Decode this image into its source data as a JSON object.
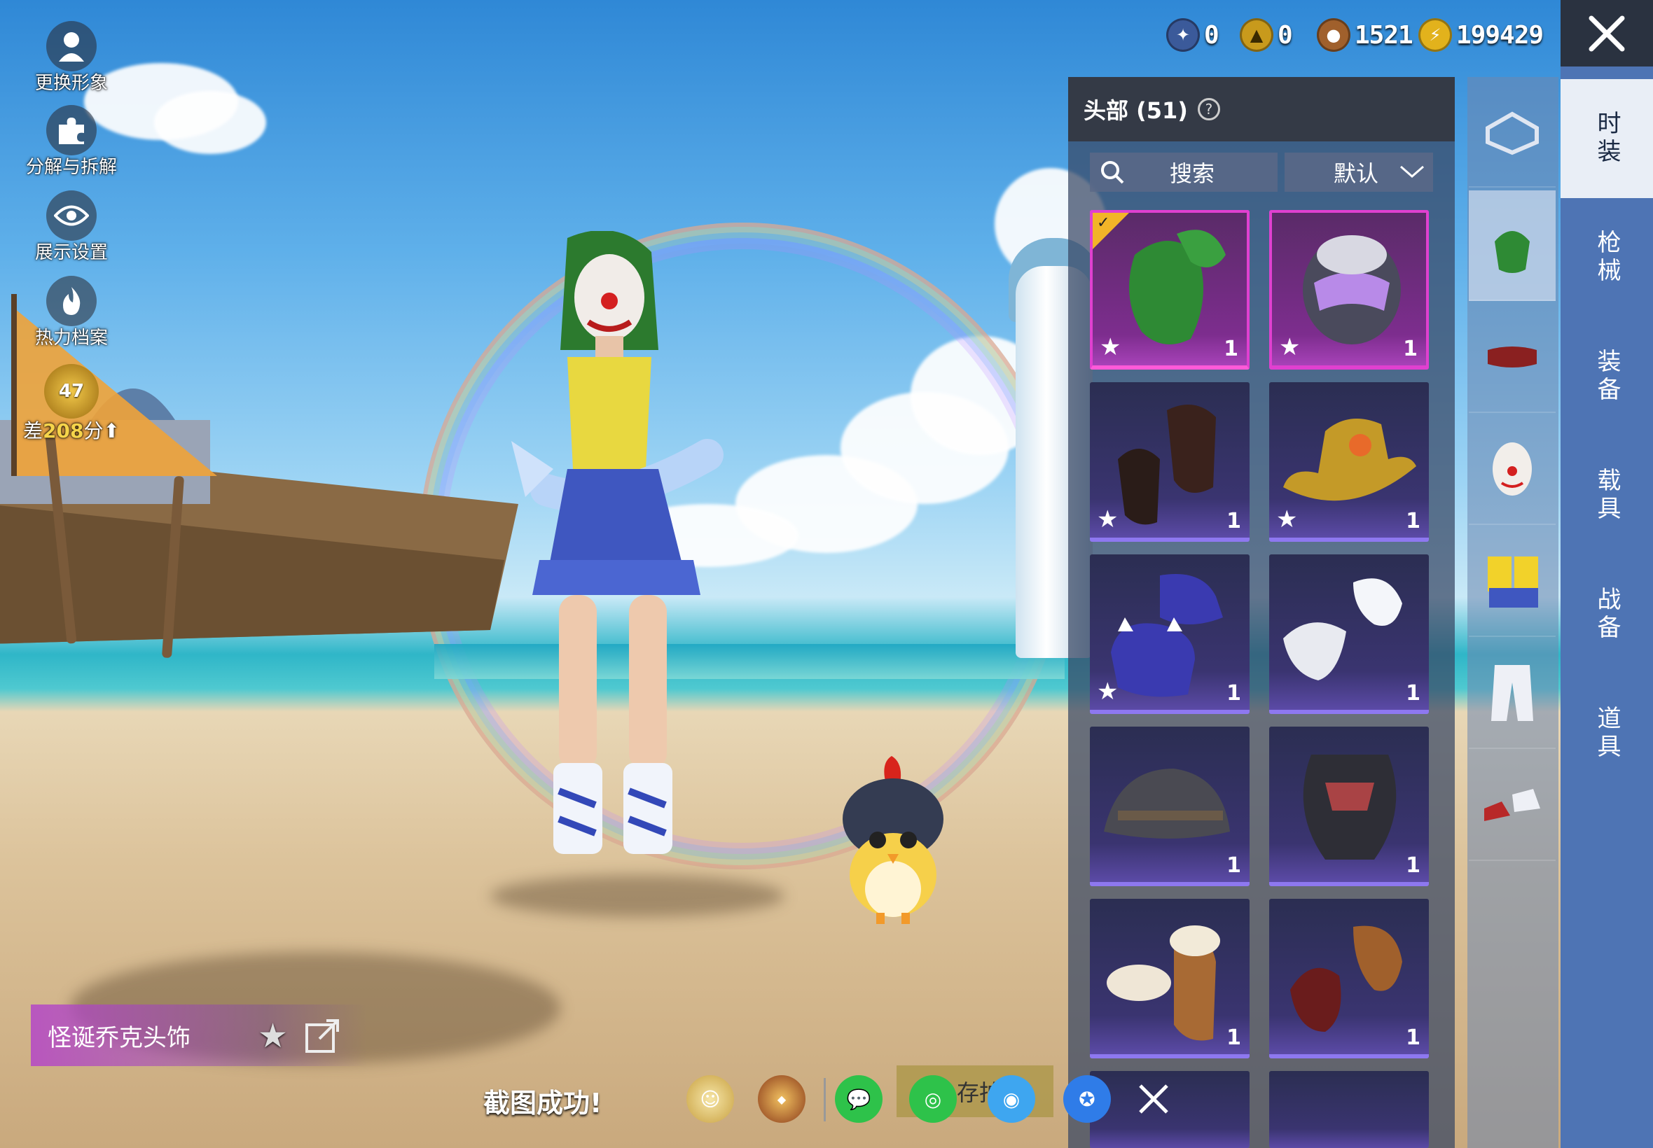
{
  "left_tools": [
    {
      "label": "更换形象",
      "icon": "person-icon"
    },
    {
      "label": "分解与拆解",
      "icon": "puzzle-icon"
    },
    {
      "label": "展示设置",
      "icon": "eye-icon"
    },
    {
      "label": "热力档案",
      "icon": "flame-icon"
    }
  ],
  "rank": {
    "level": "47",
    "prefix": "差",
    "points": "208",
    "suffix": "分"
  },
  "currency": [
    {
      "icon": "token-icon",
      "value": "0",
      "color": "#3b5a9a"
    },
    {
      "icon": "badge-icon",
      "value": "0",
      "color": "#c89a1c"
    },
    {
      "icon": "bronze-coin-icon",
      "value": "1521",
      "color": "#a0602c"
    },
    {
      "icon": "lightning-coin-icon",
      "value": "199429",
      "color": "#e2b21c"
    }
  ],
  "panel": {
    "title": "头部 (51)",
    "search_label": "搜索",
    "sort_label": "默认"
  },
  "items": [
    {
      "name": "green-hair",
      "count": "1",
      "starred": true,
      "selected": true
    },
    {
      "name": "tech-helmet",
      "count": "1",
      "starred": true,
      "selected": false
    },
    {
      "name": "dark-hair",
      "count": "1",
      "starred": true,
      "selected": false
    },
    {
      "name": "cowboy-hat",
      "count": "1",
      "starred": true,
      "selected": false
    },
    {
      "name": "bucket-hat",
      "count": "1",
      "starred": true,
      "selected": false
    },
    {
      "name": "white-hair",
      "count": "1",
      "starred": false,
      "selected": false
    },
    {
      "name": "gray-bucket-hat",
      "count": "1",
      "starred": false,
      "selected": false
    },
    {
      "name": "visor-helmet",
      "count": "1",
      "starred": false,
      "selected": false
    },
    {
      "name": "beret-hair",
      "count": "1",
      "starred": false,
      "selected": false
    },
    {
      "name": "brown-hair",
      "count": "1",
      "starred": false,
      "selected": false
    }
  ],
  "sub_categories": [
    "set",
    "hair",
    "belt",
    "mask",
    "outfit",
    "pants",
    "shoes"
  ],
  "right_tabs": [
    "时装",
    "枪械",
    "装备",
    "载具",
    "战备",
    "道具"
  ],
  "selected_item_name": "怪诞乔克头饰",
  "screenshot_toast": "截图成功!",
  "share_partial_label": "存拍",
  "colors": {
    "accent": "#e040d0",
    "tab_bg": "#4e74b4",
    "item_bg": "#3a3470"
  }
}
